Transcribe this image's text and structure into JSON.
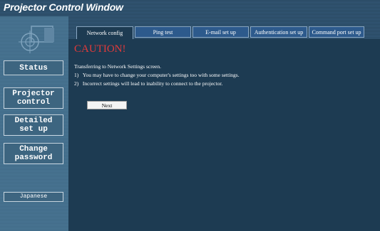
{
  "window": {
    "title": "Projector Control Window"
  },
  "sidebar": {
    "items": [
      {
        "label": "Status"
      },
      {
        "label": "Projector\ncontrol"
      },
      {
        "label": "Detailed\nset up"
      },
      {
        "label": "Change\npassword"
      }
    ],
    "language_label": "Japanese"
  },
  "tabs": [
    {
      "label": "Network config"
    },
    {
      "label": "Ping test"
    },
    {
      "label": "E-mail set up"
    },
    {
      "label": "Authentication set up"
    },
    {
      "label": "Command port set up"
    }
  ],
  "content": {
    "heading": "CAUTION!",
    "intro": "Transferring to Network Settings screen.",
    "points": [
      {
        "num": "1)",
        "text": "You may have to change your computer's settings too with some settings."
      },
      {
        "num": "2)",
        "text": "Incorrect settings will lead to inability to connect to the projector."
      }
    ],
    "next_label": "Next"
  },
  "colors": {
    "caution": "#e23a3a",
    "background": "#1d3b52",
    "tab": "#2d5a8c"
  },
  "icons": {
    "logo": "projector-logo-icon"
  }
}
